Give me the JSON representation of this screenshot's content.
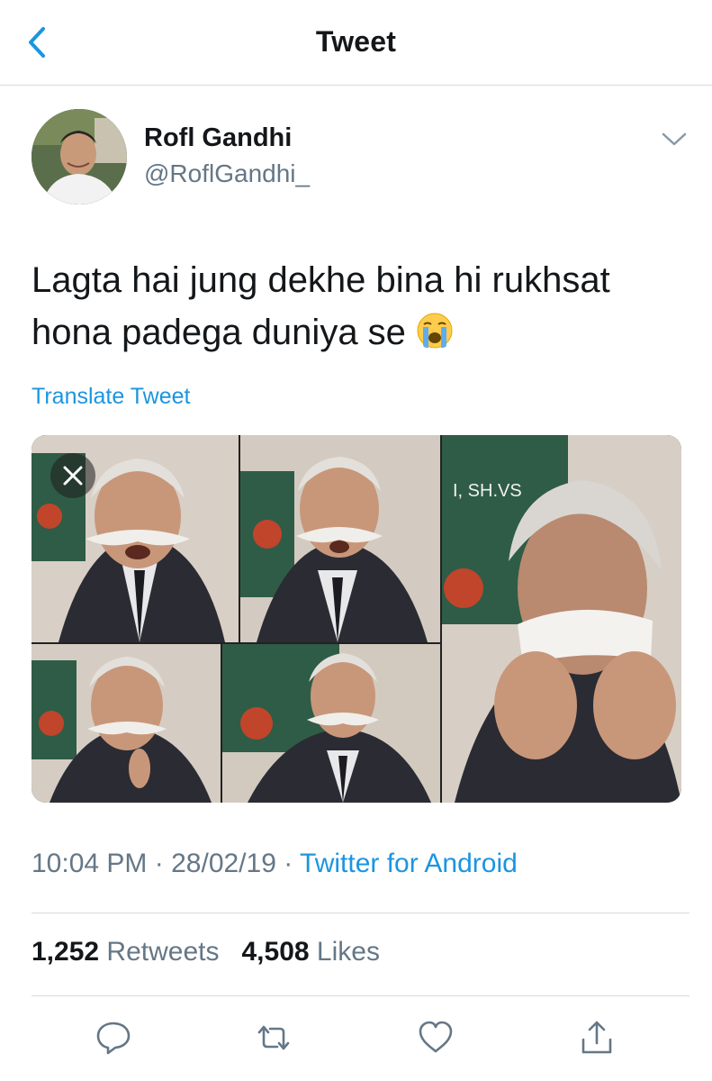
{
  "nav": {
    "title": "Tweet"
  },
  "author": {
    "name": "Rofl Gandhi",
    "handle": "@RoflGandhi_"
  },
  "tweet": {
    "text_line1": "Lagta hai jung dekhe bina hi rukhsat",
    "text_line2": "hona padega duniya se",
    "emoji": "crying-face-icon",
    "translate_label": "Translate Tweet",
    "media_caption": "I, SH.VS"
  },
  "meta": {
    "time": "10:04 PM",
    "date": "28/02/19",
    "source": "Twitter for Android",
    "separator": "·"
  },
  "stats": {
    "retweets_count": "1,252",
    "retweets_label": "Retweets",
    "likes_count": "4,508",
    "likes_label": "Likes"
  },
  "colors": {
    "link": "#1b95e0",
    "secondary": "#657786",
    "divider": "#d6d9dc"
  },
  "icons": [
    "back-chevron-icon",
    "chevron-down-icon",
    "close-icon",
    "reply-icon",
    "retweet-icon",
    "like-icon",
    "share-icon"
  ]
}
